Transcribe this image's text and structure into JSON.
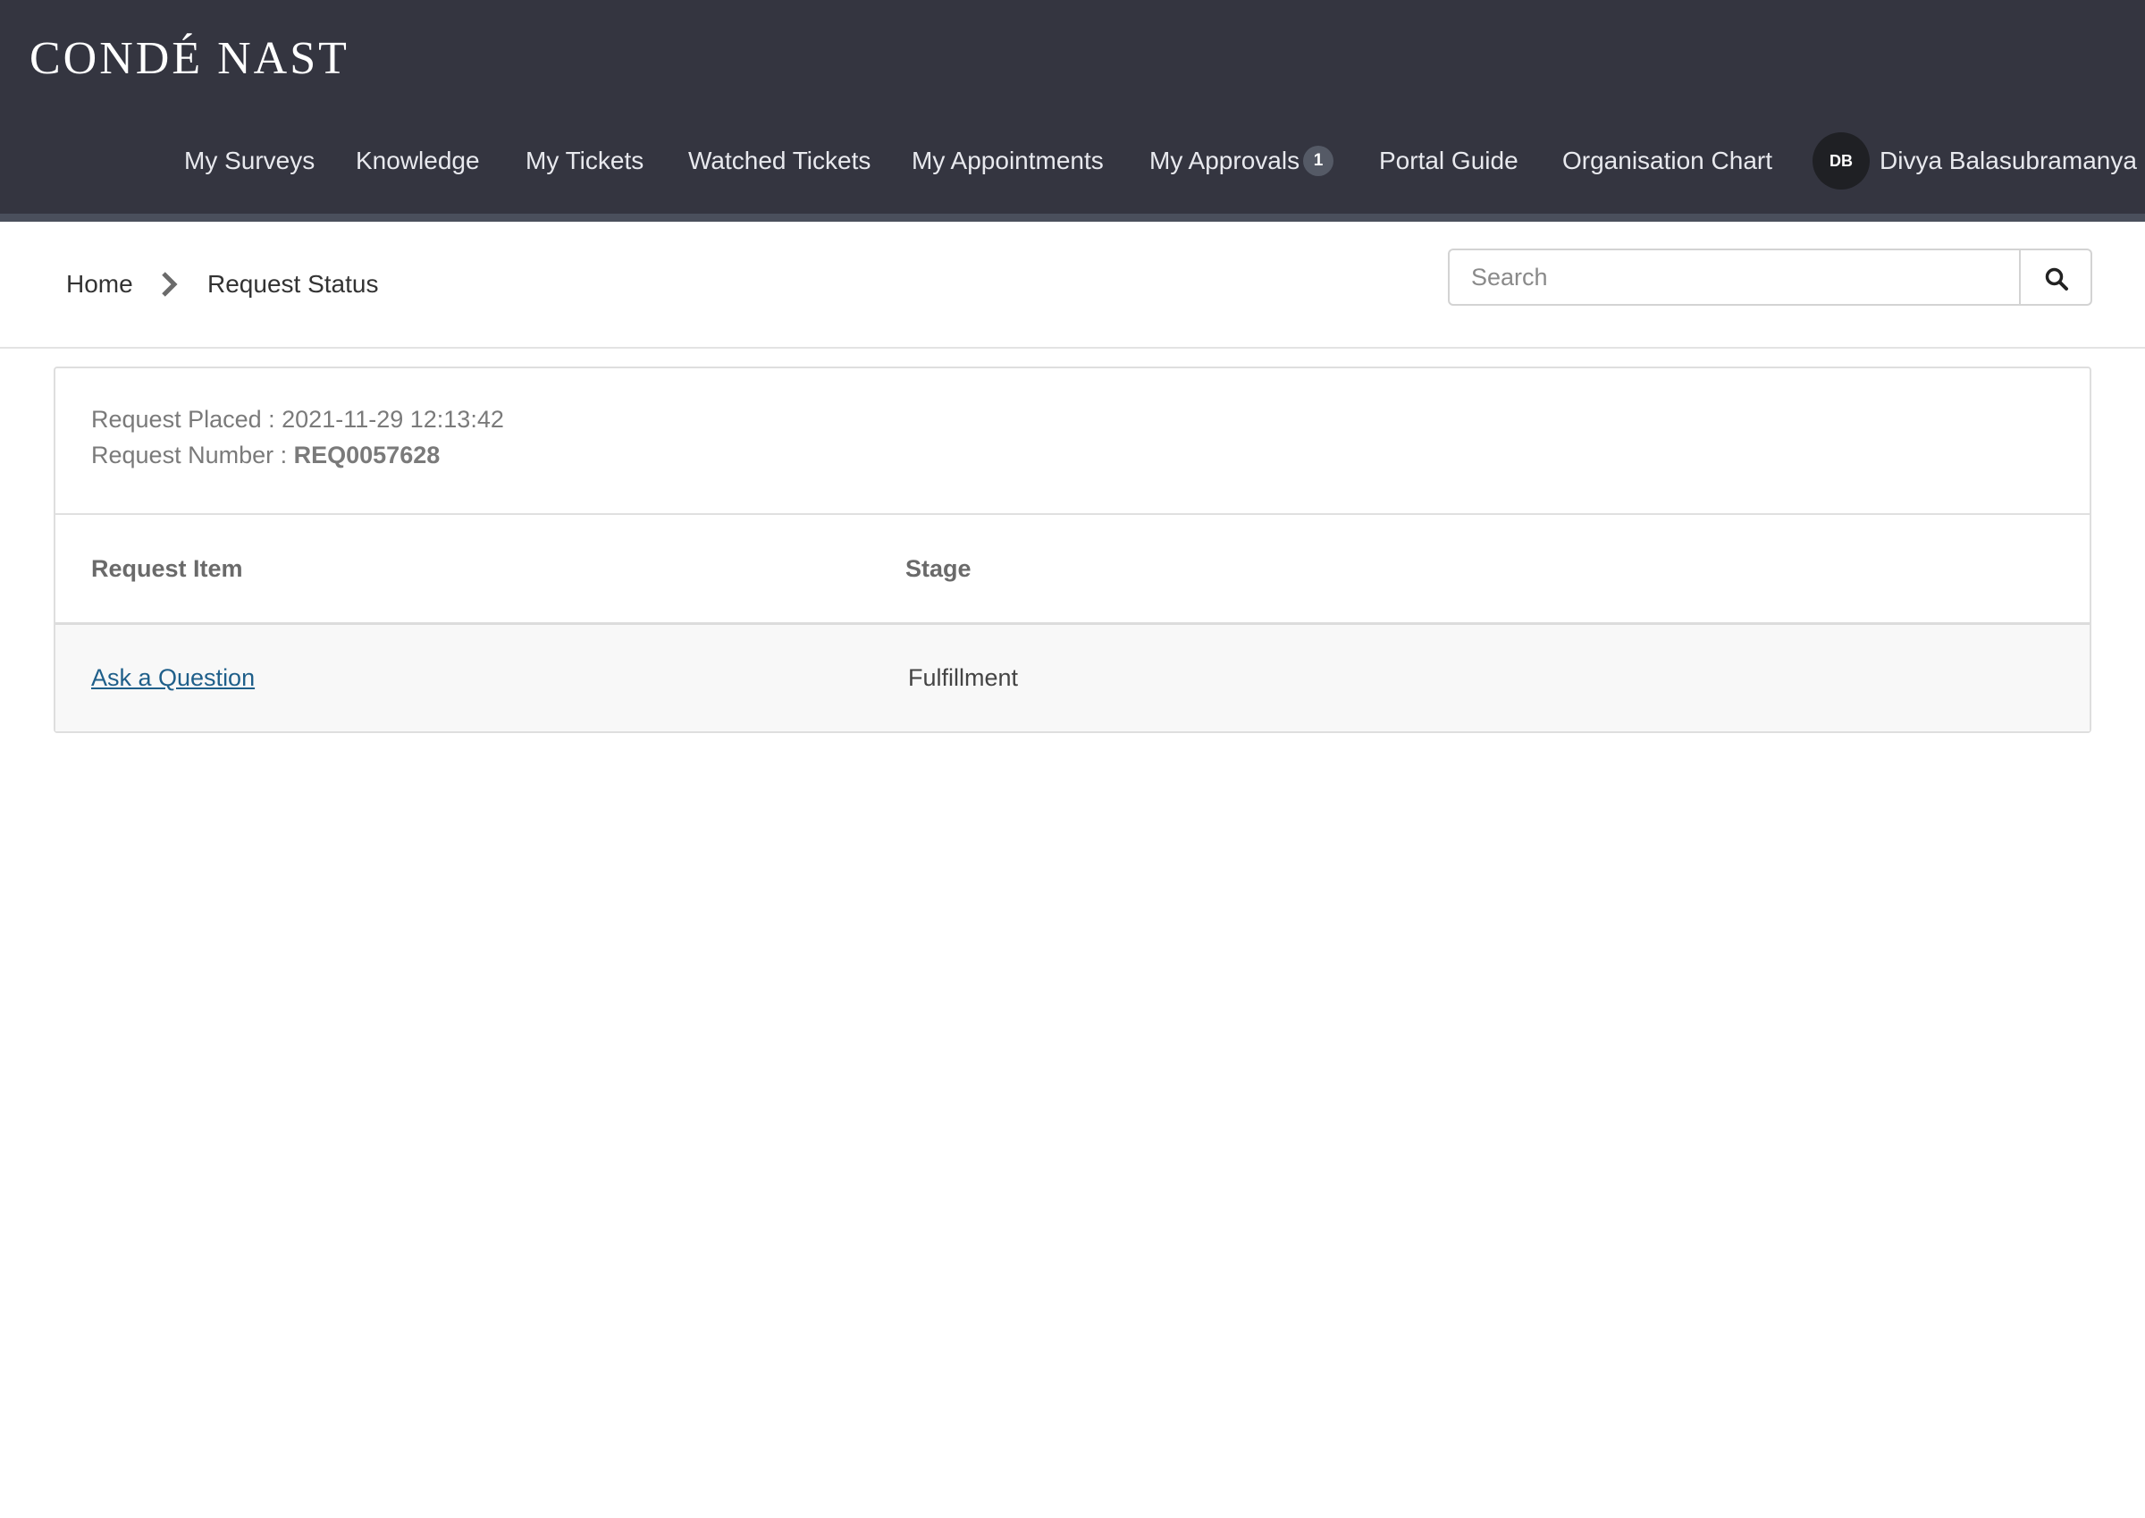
{
  "header": {
    "logo_text": "CONDÉ NAST",
    "nav": [
      {
        "label": "My Surveys"
      },
      {
        "label": "Knowledge"
      },
      {
        "label": "My Tickets"
      },
      {
        "label": "Watched Tickets"
      },
      {
        "label": "My Appointments"
      },
      {
        "label": "My Approvals",
        "badge": "1"
      },
      {
        "label": "Portal Guide"
      },
      {
        "label": "Organisation Chart"
      }
    ],
    "user": {
      "initials": "DB",
      "name": "Divya Balasubramanya"
    },
    "colors": {
      "background": "#343540",
      "text": "#e8e9ee"
    }
  },
  "breadcrumb": {
    "home": "Home",
    "current": "Request Status"
  },
  "search": {
    "placeholder": "Search"
  },
  "request": {
    "placed_label": "Request Placed :",
    "placed_value": "2021-11-29 12:13:42",
    "number_label": "Request Number :",
    "number_value": "REQ0057628",
    "table": {
      "columns": [
        "Request Item",
        "Stage"
      ],
      "rows": [
        {
          "item": "Ask a Question",
          "stage": "Fulfillment"
        }
      ]
    }
  }
}
